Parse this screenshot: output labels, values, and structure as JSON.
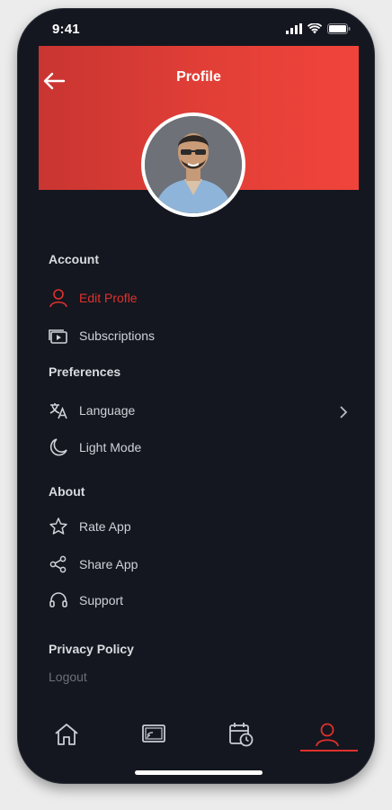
{
  "status": {
    "time": "9:41"
  },
  "header": {
    "title": "Profile"
  },
  "sections": {
    "account": "Account",
    "preferences": "Preferences",
    "about": "About"
  },
  "items": {
    "edit_profile": "Edit Profle",
    "subscriptions": "Subscriptions",
    "language": "Language",
    "light_mode": "Light Mode",
    "rate_app": "Rate App",
    "share_app": "Share App",
    "support": "Support"
  },
  "footer": {
    "privacy_policy": "Privacy Policy",
    "logout": "Logout"
  },
  "tabs": [
    {
      "icon": "home-icon"
    },
    {
      "icon": "cast-icon"
    },
    {
      "icon": "calendar-clock-icon"
    },
    {
      "icon": "profile-icon",
      "active": true
    }
  ],
  "colors": {
    "accent": "#e1312b",
    "background": "#141720",
    "header_start": "#c93531",
    "header_end": "#f0443b"
  }
}
